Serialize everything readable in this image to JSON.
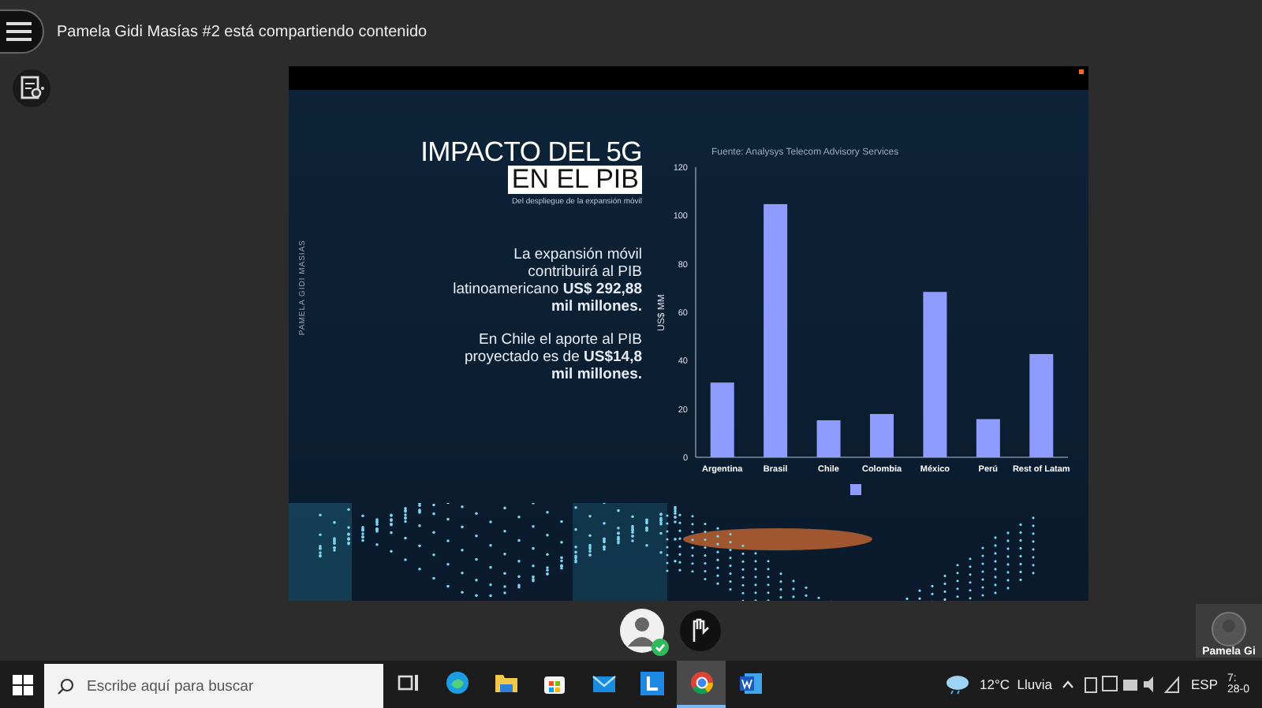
{
  "top_bar": {
    "title": "Pamela Gidi Masías #2 está compartiendo contenido"
  },
  "slide": {
    "side_caption": "PAMELA GIDI MASIAS",
    "title_line_1": "IMPACTO DEL 5G",
    "title_line_2": "EN EL PIB",
    "subtitle": "Del despliegue de la expansión móvil",
    "paragraphs": [
      "La expansión móvil contribuirá al PIB latinoamericano **US$ 292,88 mil millones.**",
      "En Chile el aporte al PIB proyectado es de **US$14,8 mil millones.**"
    ],
    "chart": {
      "chart_data": {
        "type": "bar",
        "title": "Fuente: Analysys Telecom Advisory Services",
        "ylabel": "US$ MM",
        "categories": [
          "Argentina",
          "Brasil",
          "Chile",
          "Colombia",
          "México",
          "Perú",
          "Rest of Latam"
        ],
        "series": [
          {
            "color": "#8f9cff",
            "values": [
              30.9,
              104.7,
              15.3,
              17.9,
              68.4,
              15.8,
              42.7
            ]
          }
        ],
        "ylim": [
          0,
          120
        ],
        "yticks": [
          0,
          20,
          40,
          60,
          80,
          100,
          120
        ]
      }
    }
  },
  "participant": {
    "name": "Pamela Gi"
  },
  "taskbar": {
    "search": {
      "placeholder": "Escribe aquí para buscar"
    },
    "apps": [
      {
        "kind": "taskview",
        "selected": false
      },
      {
        "kind": "edge",
        "selected": false
      },
      {
        "kind": "folder",
        "selected": false
      },
      {
        "kind": "store",
        "selected": false
      },
      {
        "kind": "mail",
        "selected": false
      },
      {
        "kind": "letter",
        "selected": false
      },
      {
        "kind": "chrome",
        "selected": true
      },
      {
        "kind": "word",
        "selected": false
      }
    ],
    "weather": "12°C  Lluvia",
    "language": "ESP",
    "time": "7:",
    "date": "28-0"
  }
}
